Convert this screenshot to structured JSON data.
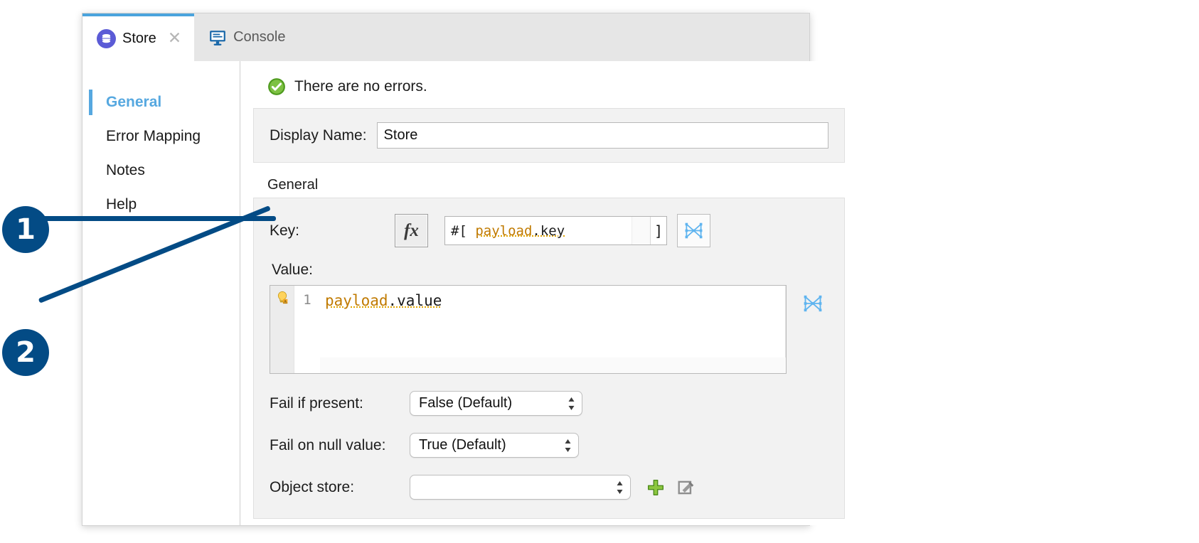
{
  "window": {
    "tabs": [
      {
        "label": "Store",
        "icon": "store-database-icon",
        "active": true,
        "closable": true
      },
      {
        "label": "Console",
        "icon": "console-monitor-icon",
        "active": false,
        "closable": false
      }
    ]
  },
  "sidebar": {
    "items": [
      {
        "label": "General",
        "active": true
      },
      {
        "label": "Error Mapping",
        "active": false
      },
      {
        "label": "Notes",
        "active": false
      },
      {
        "label": "Help",
        "active": false
      }
    ]
  },
  "status": {
    "icon": "success-check-icon",
    "message": "There are no errors."
  },
  "display_name": {
    "label": "Display Name:",
    "value": "Store"
  },
  "general_section": {
    "title": "General",
    "key": {
      "label": "Key:",
      "fx_label": "fx",
      "expr_prefix": "#[",
      "expr_object": "payload",
      "expr_property": ".key",
      "expr_suffix": "]",
      "dataweave_icon": "dataweave-icon"
    },
    "value": {
      "label": "Value:",
      "line_number": "1",
      "gutter_icon": "lightbulb-warning-icon",
      "code_object": "payload",
      "code_property": ".value",
      "dataweave_icon": "dataweave-icon"
    },
    "fail_if_present": {
      "label": "Fail if present:",
      "value": "False (Default)"
    },
    "fail_on_null_value": {
      "label": "Fail on null value:",
      "value": "True (Default)"
    },
    "object_store": {
      "label": "Object store:",
      "value": "",
      "add_icon": "plus-add-icon",
      "edit_icon": "edit-pencil-icon"
    }
  },
  "callouts": [
    {
      "number": "1"
    },
    {
      "number": "2"
    }
  ],
  "colors": {
    "accent_blue": "#56a8e0",
    "callout_blue": "#034b85",
    "expression_orange": "#c07a00",
    "success_green": "#6cb33f",
    "store_purple": "#5b5bd6"
  }
}
